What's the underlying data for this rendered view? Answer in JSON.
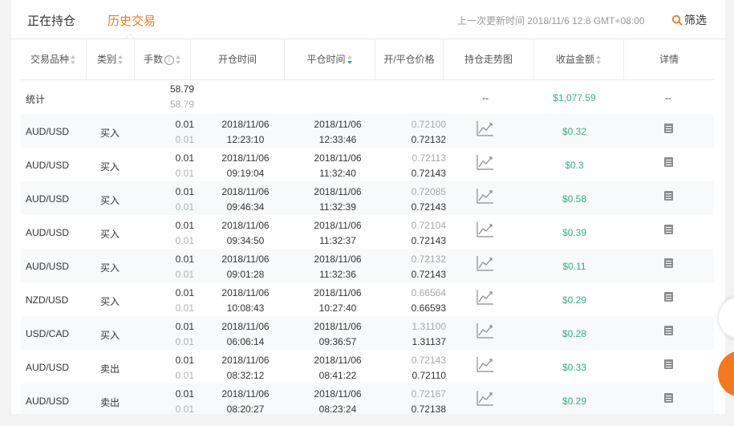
{
  "tabs": [
    {
      "label": "正在持仓",
      "active": false
    },
    {
      "label": "历史交易",
      "active": true
    }
  ],
  "update_time": "上一次更新时间 2018/11/6 12:8 GMT+08:00",
  "filter_label": "筛选",
  "columns": {
    "symbol": "交易品种",
    "type": "类别",
    "lots": "手数",
    "open_time": "开仓时间",
    "close_time": "平仓时间",
    "price": "开/平仓价格",
    "trend": "持仓走势图",
    "profit": "收益金额",
    "detail": "详情"
  },
  "summary": {
    "label": "统计",
    "lots_top": "58.79",
    "lots_bottom": "58.79",
    "trend": "--",
    "profit": "$1,077.59",
    "detail": "--"
  },
  "rows": [
    {
      "symbol": "AUD/USD",
      "type": "买入",
      "lots_top": "0.01",
      "lots_bottom": "0.01",
      "open_date": "2018/11/06",
      "open_time": "12:23:10",
      "close_date": "2018/11/06",
      "close_time": "12:33:46",
      "open_price": "0.72100",
      "close_price": "0.72132",
      "profit": "$0.32"
    },
    {
      "symbol": "AUD/USD",
      "type": "买入",
      "lots_top": "0.01",
      "lots_bottom": "0.01",
      "open_date": "2018/11/06",
      "open_time": "09:19:04",
      "close_date": "2018/11/06",
      "close_time": "11:32:40",
      "open_price": "0.72113",
      "close_price": "0.72143",
      "profit": "$0.3"
    },
    {
      "symbol": "AUD/USD",
      "type": "买入",
      "lots_top": "0.01",
      "lots_bottom": "0.01",
      "open_date": "2018/11/06",
      "open_time": "09:46:34",
      "close_date": "2018/11/06",
      "close_time": "11:32:39",
      "open_price": "0.72085",
      "close_price": "0.72143",
      "profit": "$0.58"
    },
    {
      "symbol": "AUD/USD",
      "type": "买入",
      "lots_top": "0.01",
      "lots_bottom": "0.01",
      "open_date": "2018/11/06",
      "open_time": "09:34:50",
      "close_date": "2018/11/06",
      "close_time": "11:32:37",
      "open_price": "0.72104",
      "close_price": "0.72143",
      "profit": "$0.39"
    },
    {
      "symbol": "AUD/USD",
      "type": "买入",
      "lots_top": "0.01",
      "lots_bottom": "0.01",
      "open_date": "2018/11/06",
      "open_time": "09:01:28",
      "close_date": "2018/11/06",
      "close_time": "11:32:36",
      "open_price": "0.72132",
      "close_price": "0.72143",
      "profit": "$0.11"
    },
    {
      "symbol": "NZD/USD",
      "type": "买入",
      "lots_top": "0.01",
      "lots_bottom": "0.01",
      "open_date": "2018/11/06",
      "open_time": "10:08:43",
      "close_date": "2018/11/06",
      "close_time": "10:27:40",
      "open_price": "0.66564",
      "close_price": "0.66593",
      "profit": "$0.29"
    },
    {
      "symbol": "USD/CAD",
      "type": "买入",
      "lots_top": "0.01",
      "lots_bottom": "0.01",
      "open_date": "2018/11/06",
      "open_time": "06:06:14",
      "close_date": "2018/11/06",
      "close_time": "09:36:57",
      "open_price": "1.31100",
      "close_price": "1.31137",
      "profit": "$0.28"
    },
    {
      "symbol": "AUD/USD",
      "type": "卖出",
      "lots_top": "0.01",
      "lots_bottom": "0.01",
      "open_date": "2018/11/06",
      "open_time": "08:32:12",
      "close_date": "2018/11/06",
      "close_time": "08:41:22",
      "open_price": "0.72143",
      "close_price": "0.72110",
      "profit": "$0.33"
    },
    {
      "symbol": "AUD/USD",
      "type": "卖出",
      "lots_top": "0.01",
      "lots_bottom": "0.01",
      "open_date": "2018/11/06",
      "open_time": "08:20:27",
      "close_date": "2018/11/06",
      "close_time": "08:23:24",
      "open_price": "0.72167",
      "close_price": "0.72138",
      "profit": "$0.29"
    }
  ],
  "colors": {
    "accent": "#f07a1a",
    "profit": "#2fb37f",
    "sort_active": "#3a8ee6"
  }
}
